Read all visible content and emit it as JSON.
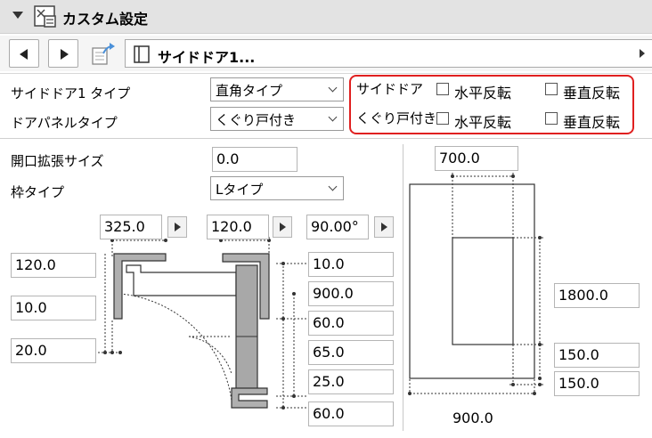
{
  "header": {
    "title": "カスタム設定",
    "icon": "custom-settings-icon"
  },
  "nav": {
    "field_label": "サイドドア1..."
  },
  "fields": {
    "side_door_type_label": "サイドドア1 タイプ",
    "side_door_type_value": "直角タイプ",
    "door_panel_type_label": "ドアパネルタイプ",
    "door_panel_type_value": "くぐり戸付き",
    "opening_ext_label": "開口拡張サイズ",
    "opening_ext_value": "0.0",
    "frame_type_label": "枠タイプ",
    "frame_type_value": "Lタイプ"
  },
  "flip": {
    "side_door_label": "サイドドア",
    "wicket_label": "くぐり戸付き",
    "horizontal": "水平反転",
    "vertical": "垂直反転"
  },
  "plan": {
    "top1": "325.0",
    "top2": "120.0",
    "top3": "90.00°",
    "left1": "120.0",
    "left2": "10.0",
    "left3": "20.0",
    "right1": "10.0",
    "right2": "900.0",
    "right3": "60.0",
    "right4": "65.0",
    "right5": "25.0",
    "right6": "60.0"
  },
  "elevation": {
    "top": "700.0",
    "height": "1800.0",
    "bottom1": "150.0",
    "bottom2": "150.0",
    "width": "900.0"
  }
}
